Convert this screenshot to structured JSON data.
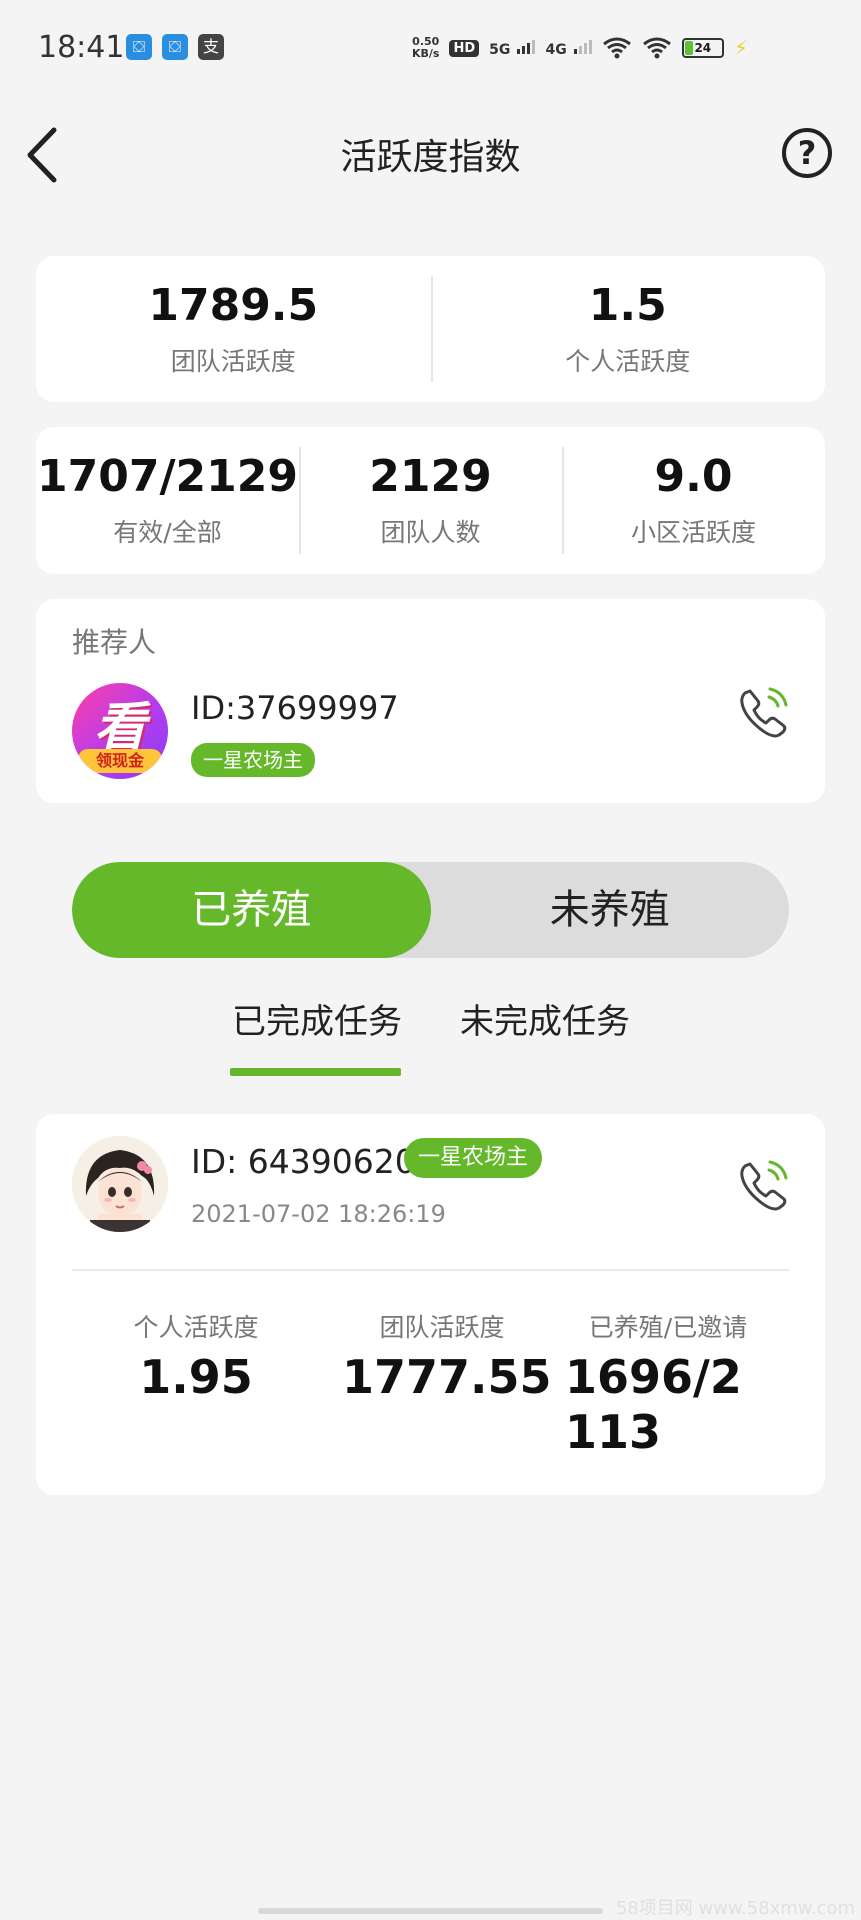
{
  "status_bar": {
    "time": "18:41",
    "app_icons": [
      "chinamobile-icon",
      "chinamobile-icon",
      "alipay-icon"
    ],
    "net_speed_value": "0.50",
    "net_speed_unit": "KB/s",
    "hd_label": "HD",
    "sim1_label": "5G",
    "sim2_label": "4G",
    "battery_level": "24",
    "battery_fraction": 0.24,
    "battery_color": "#5cc13b"
  },
  "header": {
    "title": "活跃度指数",
    "back_icon": "chevron-left-icon",
    "help_label": "?"
  },
  "summary": {
    "team_activity_value": "1789.5",
    "team_activity_label": "团队活跃度",
    "personal_activity_value": "1.5",
    "personal_activity_label": "个人活跃度"
  },
  "team_stats": {
    "valid_total_value": "1707/2129",
    "valid_total_label": "有效/全部",
    "team_count_value": "2129",
    "team_count_label": "团队人数",
    "subarea_activity_value": "9.0",
    "subarea_activity_label": "小区活跃度"
  },
  "referrer": {
    "title": "推荐人",
    "id": "ID:37699997",
    "badge": "一星农场主",
    "avatar_char": "看",
    "avatar_ribbon": "领现金"
  },
  "segment": {
    "active_label": "已养殖",
    "inactive_label": "未养殖"
  },
  "tabs": {
    "completed": "已完成任务",
    "incomplete": "未完成任务"
  },
  "member": {
    "id": "ID: 64390620",
    "badge": "一星农场主",
    "time": "2021-07-02 18:26:19",
    "personal_label": "个人活跃度",
    "personal_value": "1.95",
    "team_label": "团队活跃度",
    "team_value": "1777.55",
    "ratio_label": "已养殖/已邀请",
    "ratio_value": "1696/2113"
  },
  "colors": {
    "accent_green": "#64b82a",
    "background": "#f4f4f4"
  },
  "watermark": "58项目网 www.58xmw.com"
}
